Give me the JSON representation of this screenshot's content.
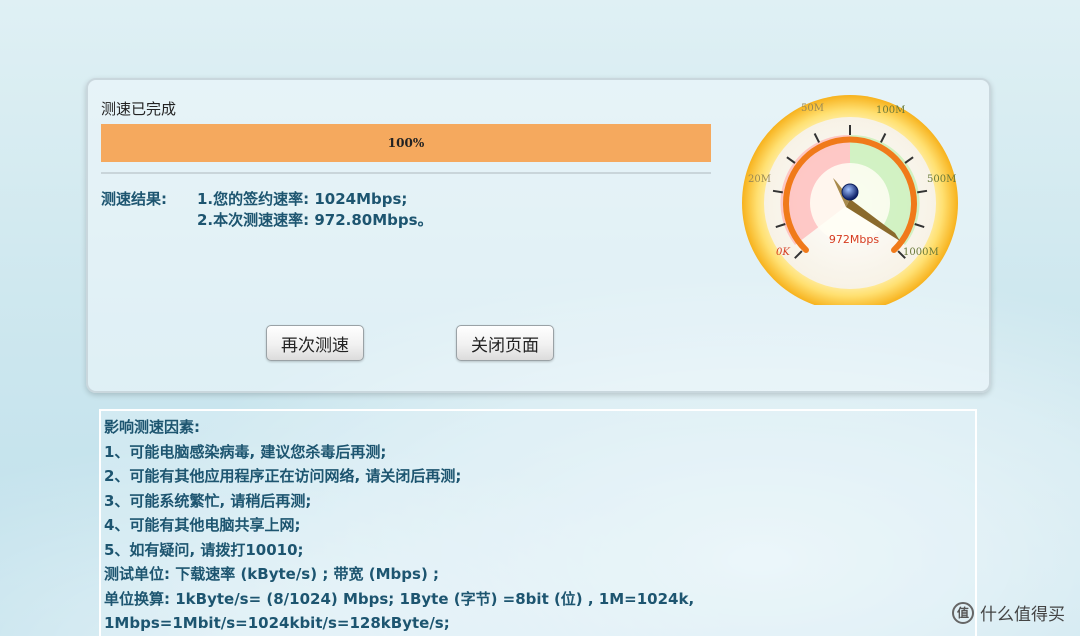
{
  "status": {
    "text": "测速已完成"
  },
  "progress": {
    "value": 100,
    "label": "100%"
  },
  "result": {
    "label": "测速结果:",
    "line1": "1.您的签约速率: 1024Mbps;",
    "line2": "2.本次测速速率: 972.80Mbps。"
  },
  "buttons": {
    "retest": "再次测速",
    "close": "关闭页面"
  },
  "gauge": {
    "ticks": [
      "0K",
      "20M",
      "50M",
      "100M",
      "500M",
      "1000M"
    ],
    "reading": "972Mbps",
    "value_mbps": 972.8
  },
  "factors": {
    "lines": [
      "影响测速因素:",
      "1、可能电脑感染病毒, 建议您杀毒后再测;",
      "2、可能有其他应用程序正在访问网络, 请关闭后再测;",
      "3、可能系统繁忙, 请稍后再测;",
      "4、可能有其他电脑共享上网;",
      "5、如有疑问, 请拨打10010;",
      "测试单位: 下载速率 (kByte/s) ; 带宽 (Mbps) ;",
      "单位换算: 1kByte/s= (8/1024) Mbps; 1Byte (字节) =8bit (位) , 1M=1024k,",
      "1Mbps=1Mbit/s=1024kbit/s=128kByte/s;"
    ]
  },
  "watermark": {
    "badge": "值",
    "text": "什么值得买"
  },
  "colors": {
    "progress": "#f5a95e",
    "text_blue": "#1d5570",
    "gauge_orange": "#f07a1a"
  }
}
